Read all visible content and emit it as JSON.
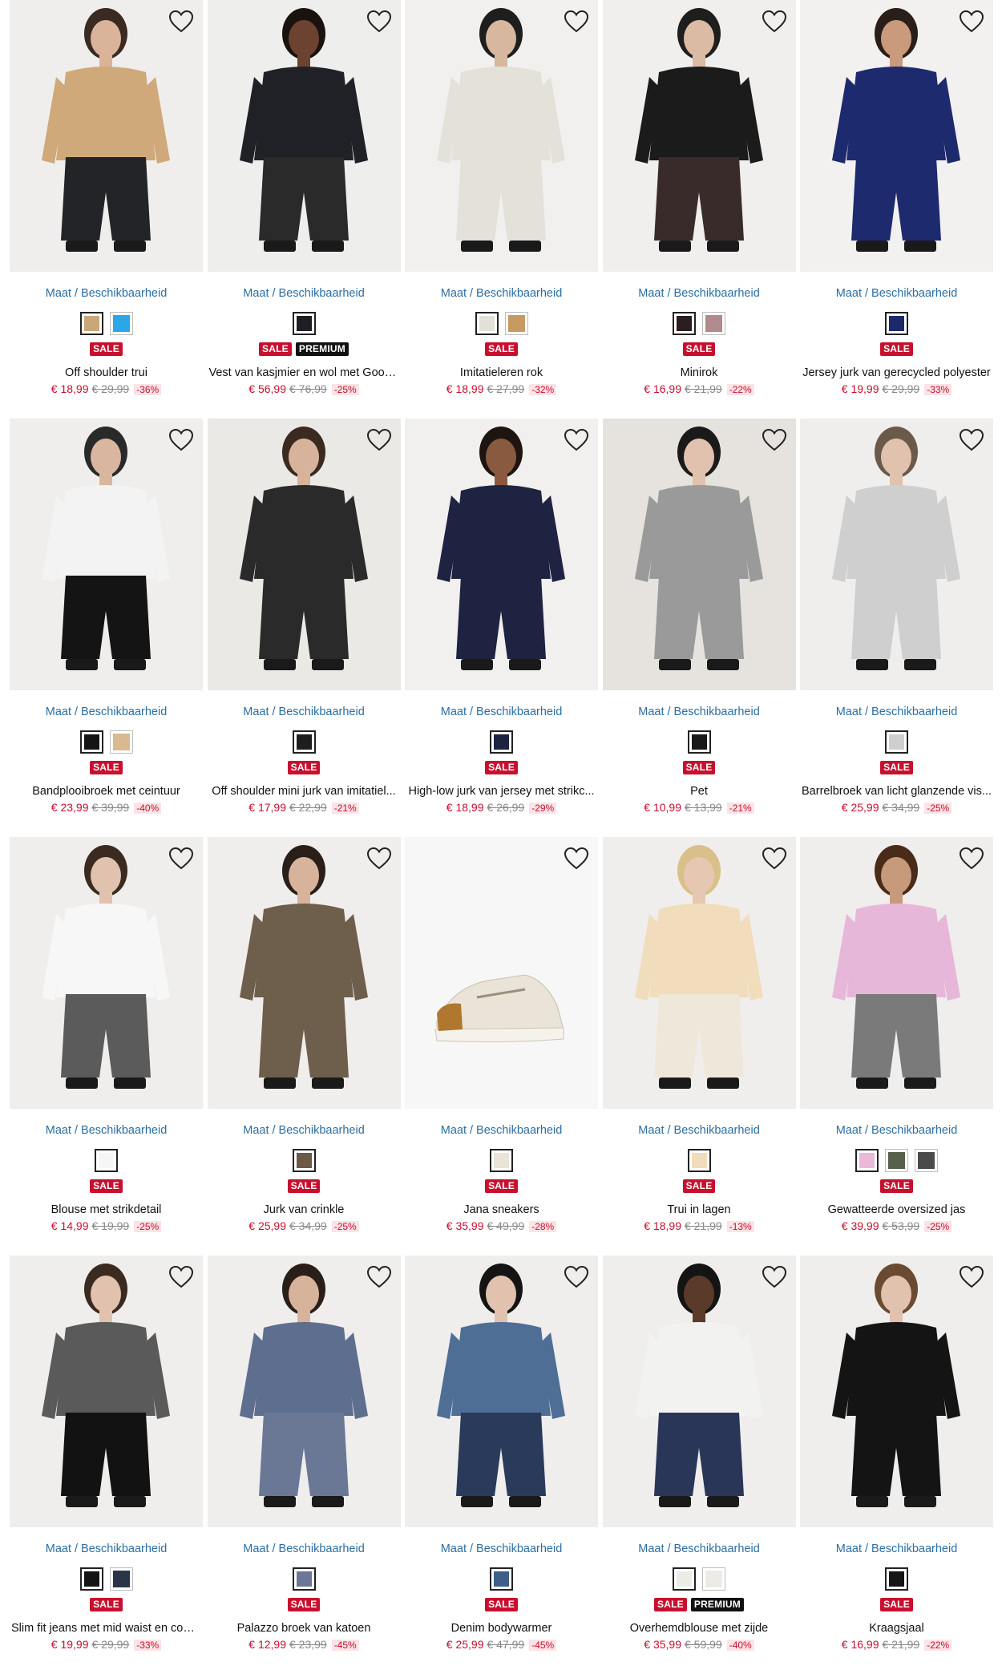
{
  "availability_label": "Maat / Beschikbaarheid",
  "colors": {
    "sale": "#c8102e",
    "premium": "#111111",
    "link": "#2b6ea3"
  },
  "products": [
    {
      "title": "Off shoulder trui",
      "price": "€ 18,99",
      "old_price": "€ 29,99",
      "discount": "-36%",
      "badges": [
        "SALE"
      ],
      "swatches": [
        "#c9a778",
        "#2ba6e8"
      ],
      "img": {
        "bg": "#efeeec",
        "top": "#cfa97a",
        "bottom": "#222428",
        "skin": "#d9b39a",
        "hair": "#3a2a22"
      }
    },
    {
      "title": "Vest van kasjmier en wol met Good ...",
      "price": "€ 56,99",
      "old_price": "€ 76,99",
      "discount": "-25%",
      "badges": [
        "SALE",
        "PREMIUM"
      ],
      "swatches": [
        "#1d1f24"
      ],
      "img": {
        "bg": "#eeeeec",
        "top": "#1f2126",
        "bottom": "#2a2a2a",
        "skin": "#6b4330",
        "hair": "#1a120e"
      }
    },
    {
      "title": "Imitatieleren rok",
      "price": "€ 18,99",
      "old_price": "€ 27,99",
      "discount": "-32%",
      "badges": [
        "SALE"
      ],
      "swatches": [
        "#e3e0d8",
        "#c79a62"
      ],
      "img": {
        "bg": "#f1f0ee",
        "top": "#e4e1d9",
        "bottom": "#e4e1d9",
        "skin": "#d8b79f",
        "hair": "#1e1e1e"
      }
    },
    {
      "title": "Minirok",
      "price": "€ 16,99",
      "old_price": "€ 21,99",
      "discount": "-22%",
      "badges": [
        "SALE"
      ],
      "swatches": [
        "#2a1e1e",
        "#b08a8c"
      ],
      "img": {
        "bg": "#f0efed",
        "top": "#1b1b1b",
        "bottom": "#3a2b2b",
        "skin": "#dcbba4",
        "hair": "#1e1e1e"
      }
    },
    {
      "title": "Jersey jurk van gerecycled polyester",
      "price": "€ 19,99",
      "old_price": "€ 29,99",
      "discount": "-33%",
      "badges": [
        "SALE"
      ],
      "swatches": [
        "#1c2a6a"
      ],
      "img": {
        "bg": "#f2f1ef",
        "top": "#1e2a6e",
        "bottom": "#1e2a6e",
        "skin": "#c99a7c",
        "hair": "#2a1e18"
      }
    },
    {
      "title": "Bandplooibroek met ceintuur",
      "price": "€ 23,99",
      "old_price": "€ 39,99",
      "discount": "-40%",
      "badges": [
        "SALE"
      ],
      "swatches": [
        "#141414",
        "#d8b990"
      ],
      "img": {
        "bg": "#efeeec",
        "top": "#f3f3f3",
        "bottom": "#141414",
        "skin": "#d9b6a0",
        "hair": "#2a2a2a"
      }
    },
    {
      "title": "Off shoulder mini jurk van imitatiel...",
      "price": "€ 17,99",
      "old_price": "€ 22,99",
      "discount": "-21%",
      "badges": [
        "SALE"
      ],
      "swatches": [
        "#1e1e1e"
      ],
      "img": {
        "bg": "#eae9e6",
        "top": "#2a2a2a",
        "bottom": "#2a2a2a",
        "skin": "#d8b39c",
        "hair": "#3a2a20"
      }
    },
    {
      "title": "High-low jurk van jersey met strikc...",
      "price": "€ 18,99",
      "old_price": "€ 26,99",
      "discount": "-29%",
      "badges": [
        "SALE"
      ],
      "swatches": [
        "#1d2340"
      ],
      "img": {
        "bg": "#f1f0ee",
        "top": "#1d2340",
        "bottom": "#1d2340",
        "skin": "#8a5a40",
        "hair": "#1e1410"
      }
    },
    {
      "title": "Pet",
      "price": "€ 10,99",
      "old_price": "€ 13,99",
      "discount": "-21%",
      "badges": [
        "SALE"
      ],
      "swatches": [
        "#1a1a1a"
      ],
      "img": {
        "bg": "#e6e3de",
        "top": "#9a9a9a",
        "bottom": "#9a9a9a",
        "skin": "#e0c2ae",
        "hair": "#1a1a1a"
      }
    },
    {
      "title": "Barrelbroek van licht glanzende vis...",
      "price": "€ 25,99",
      "old_price": "€ 34,99",
      "discount": "-25%",
      "badges": [
        "SALE"
      ],
      "swatches": [
        "#cfcfcf"
      ],
      "img": {
        "bg": "#efeeec",
        "top": "#cfcfcf",
        "bottom": "#cfcfcf",
        "skin": "#e0c2ae",
        "hair": "#6b5a4a"
      }
    },
    {
      "title": "Blouse met strikdetail",
      "price": "€ 14,99",
      "old_price": "€ 19,99",
      "discount": "-25%",
      "badges": [
        "SALE"
      ],
      "swatches": [
        "#f6f6f6"
      ],
      "img": {
        "bg": "#efeeec",
        "top": "#f7f7f7",
        "bottom": "#5b5b5b",
        "skin": "#e0c2ae",
        "hair": "#3b2a20"
      }
    },
    {
      "title": "Jurk van crinkle",
      "price": "€ 25,99",
      "old_price": "€ 34,99",
      "discount": "-25%",
      "badges": [
        "SALE"
      ],
      "swatches": [
        "#6b5a48"
      ],
      "img": {
        "bg": "#efeeec",
        "top": "#6e5e4c",
        "bottom": "#6e5e4c",
        "skin": "#d8b39c",
        "hair": "#2a1e18"
      }
    },
    {
      "title": "Jana sneakers",
      "price": "€ 35,99",
      "old_price": "€ 49,99",
      "discount": "-28%",
      "badges": [
        "SALE"
      ],
      "swatches": [
        "#e9e3d8"
      ],
      "img": {
        "bg": "#f7f7f7",
        "top": "#e9e3d8",
        "bottom": "#b0772f",
        "skin": "#f7f7f7",
        "hair": "#f7f7f7"
      }
    },
    {
      "title": "Trui in lagen",
      "price": "€ 18,99",
      "old_price": "€ 21,99",
      "discount": "-13%",
      "badges": [
        "SALE"
      ],
      "swatches": [
        "#f1dcbc"
      ],
      "img": {
        "bg": "#efeeec",
        "top": "#f1dcbc",
        "bottom": "#efe8da",
        "skin": "#e6c8b2",
        "hair": "#d9c08a"
      }
    },
    {
      "title": "Gewatteerde oversized jas",
      "price": "€ 39,99",
      "old_price": "€ 53,99",
      "discount": "-25%",
      "badges": [
        "SALE"
      ],
      "swatches": [
        "#eab9d8",
        "#56604a",
        "#4a4a4a"
      ],
      "img": {
        "bg": "#efeeec",
        "top": "#e7b7da",
        "bottom": "#7a7a7a",
        "skin": "#c89a7c",
        "hair": "#4a2a18"
      }
    },
    {
      "title": "Slim fit jeans met mid waist en com...",
      "price": "€ 19,99",
      "old_price": "€ 29,99",
      "discount": "-33%",
      "badges": [
        "SALE"
      ],
      "swatches": [
        "#141414",
        "#2a3448"
      ],
      "img": {
        "bg": "#efeeec",
        "top": "#5a5a5a",
        "bottom": "#121212",
        "skin": "#e0c2ae",
        "hair": "#3b2a20"
      }
    },
    {
      "title": "Palazzo broek van katoen",
      "price": "€ 12,99",
      "old_price": "€ 23,99",
      "discount": "-45%",
      "badges": [
        "SALE"
      ],
      "swatches": [
        "#6a7896"
      ],
      "img": {
        "bg": "#efeeec",
        "top": "#5e6e8e",
        "bottom": "#6a7896",
        "skin": "#d8b39c",
        "hair": "#2a1e18"
      }
    },
    {
      "title": "Denim bodywarmer",
      "price": "€ 25,99",
      "old_price": "€ 47,99",
      "discount": "-45%",
      "badges": [
        "SALE"
      ],
      "swatches": [
        "#3d5f8a"
      ],
      "img": {
        "bg": "#efeeec",
        "top": "#4e6e96",
        "bottom": "#2a3a5a",
        "skin": "#e0c2ae",
        "hair": "#141414"
      }
    },
    {
      "title": "Overhemdblouse met zijde",
      "price": "€ 35,99",
      "old_price": "€ 59,99",
      "discount": "-40%",
      "badges": [
        "SALE",
        "PREMIUM"
      ],
      "swatches": [
        "#ecebe6",
        "#ecebe6"
      ],
      "img": {
        "bg": "#efeeec",
        "top": "#f2f2f0",
        "bottom": "#2a3658",
        "skin": "#5a3a28",
        "hair": "#141414"
      }
    },
    {
      "title": "Kraagsjaal",
      "price": "€ 16,99",
      "old_price": "€ 21,99",
      "discount": "-22%",
      "badges": [
        "SALE"
      ],
      "swatches": [
        "#151515"
      ],
      "img": {
        "bg": "#efeeec",
        "top": "#141414",
        "bottom": "#141414",
        "skin": "#e0c2ae",
        "hair": "#6a4a30"
      }
    }
  ]
}
